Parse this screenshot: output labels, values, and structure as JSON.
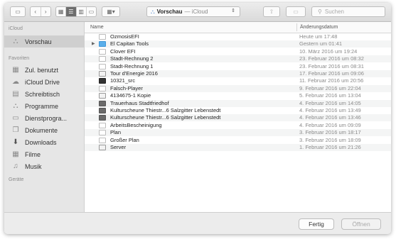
{
  "toolbar": {
    "location_label": "Vorschau",
    "location_sub": "— iCloud",
    "search_placeholder": "Suchen"
  },
  "sidebar": {
    "icloud_heading": "iCloud",
    "icloud_items": [
      {
        "label": "Vorschau",
        "icon": "preview-app-icon",
        "glyph": "⛬"
      }
    ],
    "favorites_heading": "Favoriten",
    "favorites_items": [
      {
        "label": "Zul. benutzt",
        "icon": "recents-icon",
        "glyph": "▦"
      },
      {
        "label": "iCloud Drive",
        "icon": "cloud-icon",
        "glyph": "☁"
      },
      {
        "label": "Schreibtisch",
        "icon": "desktop-icon",
        "glyph": "▤"
      },
      {
        "label": "Programme",
        "icon": "applications-icon",
        "glyph": "⛬"
      },
      {
        "label": "Dienstprogra...",
        "icon": "folder-icon",
        "glyph": "▭"
      },
      {
        "label": "Dokumente",
        "icon": "documents-icon",
        "glyph": "❐"
      },
      {
        "label": "Downloads",
        "icon": "downloads-icon",
        "glyph": "⬇"
      },
      {
        "label": "Filme",
        "icon": "movies-icon",
        "glyph": "▦"
      },
      {
        "label": "Musik",
        "icon": "music-icon",
        "glyph": "♫"
      }
    ],
    "devices_heading": "Geräte"
  },
  "list": {
    "col_name": "Name",
    "col_date": "Änderungsdatum",
    "rows": [
      {
        "name": "OzmosisEFI",
        "date": "Heute um 17:48",
        "icon": "doc",
        "disc": false
      },
      {
        "name": "El Capitan Tools",
        "date": "Gestern um 01:41",
        "icon": "folder",
        "disc": true
      },
      {
        "name": "Clover EFI",
        "date": "10. März 2016 um 19:24",
        "icon": "doc",
        "disc": false
      },
      {
        "name": "Stadt-Rechnung 2",
        "date": "23. Februar 2016 um 08:32",
        "icon": "doc",
        "disc": false
      },
      {
        "name": "Stadt-Rechnung 1",
        "date": "23. Februar 2016 um 08:31",
        "icon": "doc",
        "disc": false
      },
      {
        "name": "Tour d'Energie 2016",
        "date": "17. Februar 2016 um 09:06",
        "icon": "pdf",
        "disc": false
      },
      {
        "name": "10321_src",
        "date": "11. Februar 2016 um 20:56",
        "icon": "dark",
        "disc": false
      },
      {
        "name": "Falsch-Player",
        "date": "9. Februar 2016 um 22:04",
        "icon": "doc",
        "disc": false
      },
      {
        "name": "4134675-1 Kopie",
        "date": "5. Februar 2016 um 13:04",
        "icon": "pdf",
        "disc": false
      },
      {
        "name": "Trauerhaus Stadtfriedhof",
        "date": "4. Februar 2016 um 14:05",
        "icon": "media",
        "disc": false
      },
      {
        "name": "Kulturscheune Thiestr...6 Salzgitter Lebenstedt",
        "date": "4. Februar 2016 um 13:49",
        "icon": "media",
        "disc": false
      },
      {
        "name": "Kulturscheune Thiestr...6 Salzgitter Lebenstedt",
        "date": "4. Februar 2016 um 13:46",
        "icon": "media",
        "disc": false
      },
      {
        "name": "ArbeitsBescheinigung",
        "date": "4. Februar 2016 um 09:09",
        "icon": "doc",
        "disc": false
      },
      {
        "name": "Plan",
        "date": "3. Februar 2016 um 18:17",
        "icon": "doc",
        "disc": false
      },
      {
        "name": "Großer Plan",
        "date": "3. Februar 2016 um 18:09",
        "icon": "doc",
        "disc": false
      },
      {
        "name": "Server",
        "date": "1. Februar 2016 um 21:26",
        "icon": "pdf",
        "disc": false
      }
    ]
  },
  "buttons": {
    "done": "Fertig",
    "open": "Öffnen"
  }
}
